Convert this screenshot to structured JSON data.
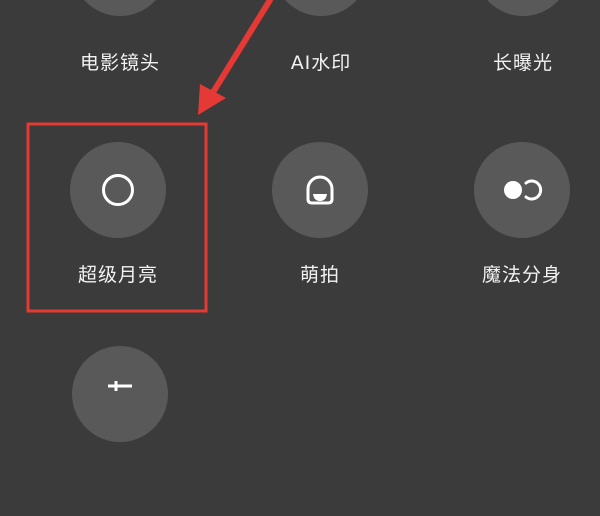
{
  "modes": {
    "row1": [
      {
        "label": "电影镜头",
        "icon": "film-lens-icon"
      },
      {
        "label": "AI水印",
        "icon": "ai-watermark-icon"
      },
      {
        "label": "长曝光",
        "icon": "long-exposure-icon"
      }
    ],
    "row2": [
      {
        "label": "超级月亮",
        "icon": "moon-circle-icon"
      },
      {
        "label": "萌拍",
        "icon": "cute-shot-icon"
      },
      {
        "label": "魔法分身",
        "icon": "clone-icon"
      }
    ],
    "row3": [
      {
        "label": "",
        "icon": "adjust-icon"
      }
    ]
  },
  "colors": {
    "background": "#3b3b3b",
    "tile": "#595959",
    "text": "#f2f2f2",
    "annotation": "#e53935"
  }
}
